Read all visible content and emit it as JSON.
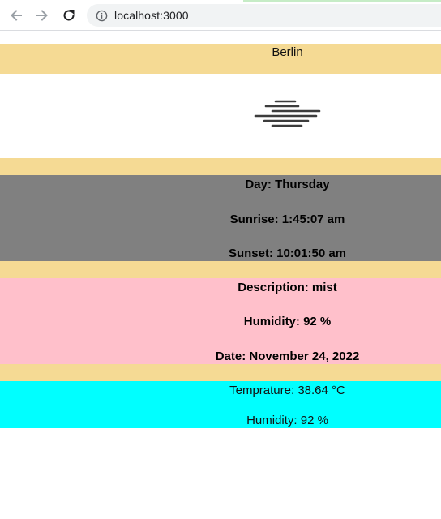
{
  "browser": {
    "url": "localhost:3000",
    "back_icon": "arrow-left-icon",
    "forward_icon": "arrow-right-icon",
    "reload_icon": "reload-icon",
    "info_icon": "info-icon"
  },
  "weather": {
    "city": "Berlin",
    "icon": "mist-icon",
    "day_box": {
      "day": "Day: Thursday",
      "sunrise": "Sunrise: 1:45:07 am",
      "sunset": "Sunset: 10:01:50 am"
    },
    "details_box": {
      "description": "Description: mist",
      "humidity": "Humidity: 92 %",
      "date": "Date: November 24, 2022"
    },
    "summary_box": {
      "temperature": "Temprature: 38.64 °C",
      "humidity": "Humidity: 92 %"
    }
  },
  "colors": {
    "accent_band": "#f5da94",
    "day_box_bg": "#808080",
    "details_box_bg": "#ffc0cb",
    "summary_box_bg": "#00ffff"
  }
}
